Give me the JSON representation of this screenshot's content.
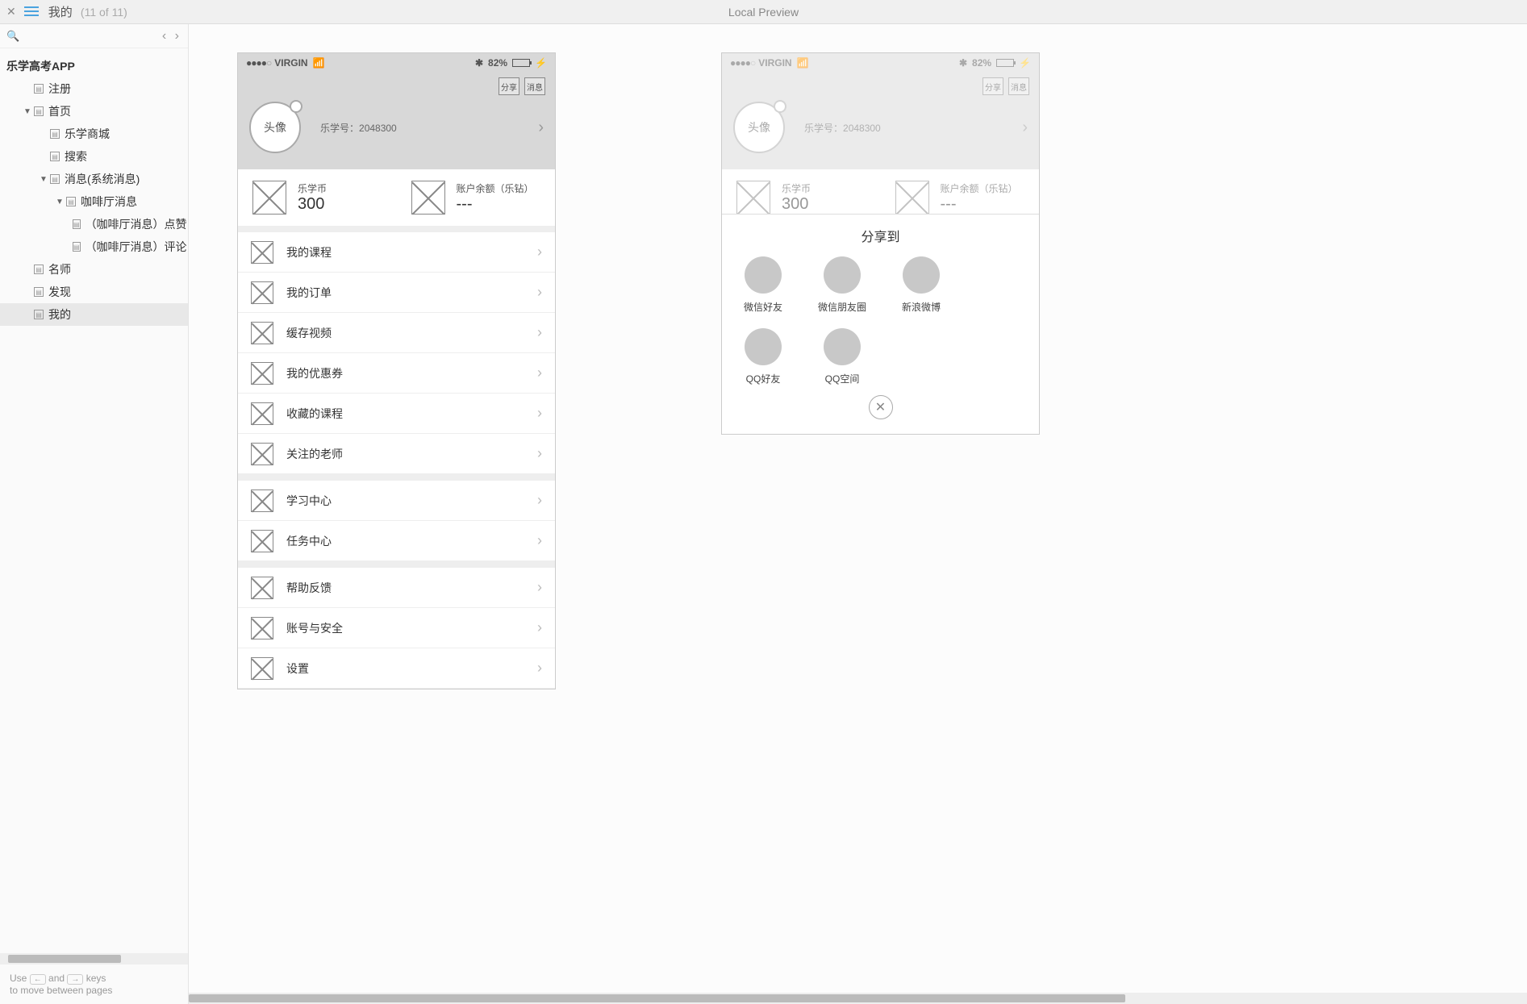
{
  "topbar": {
    "title": "我的",
    "count": "(11 of 11)",
    "preview": "Local Preview"
  },
  "tree": {
    "root": "乐学高考APP",
    "items": [
      {
        "label": "注册",
        "depth": 1
      },
      {
        "label": "首页",
        "depth": 1,
        "expandable": true
      },
      {
        "label": "乐学商城",
        "depth": 2
      },
      {
        "label": "搜索",
        "depth": 2
      },
      {
        "label": "消息(系统消息)",
        "depth": 2,
        "expandable": true
      },
      {
        "label": "咖啡厅消息",
        "depth": 3,
        "expandable": true
      },
      {
        "label": "（咖啡厅消息）点赞",
        "depth": 4
      },
      {
        "label": "（咖啡厅消息）评论",
        "depth": 4
      },
      {
        "label": "名师",
        "depth": 1
      },
      {
        "label": "发现",
        "depth": 1
      },
      {
        "label": "我的",
        "depth": 1,
        "selected": true
      }
    ]
  },
  "footer_hint1": "Use",
  "footer_hint2": "and",
  "footer_hint3": "keys",
  "footer_hint4": "to move between pages",
  "status": {
    "carrier": "VIRGIN",
    "battery": "82%"
  },
  "header": {
    "share_btn": "分享",
    "msg_btn": "消息",
    "avatar_label": "头像",
    "uid_label": "乐学号：",
    "uid": "2048300"
  },
  "balance": {
    "coin_label": "乐学币",
    "coin_value": "300",
    "balance_label": "账户余额（乐钻）",
    "balance_value": "---"
  },
  "menu_groups": [
    [
      "我的课程",
      "我的订单",
      "缓存视频",
      "我的优惠券",
      "收藏的课程",
      "关注的老师"
    ],
    [
      "学习中心",
      "任务中心"
    ],
    [
      "帮助反馈",
      "账号与安全",
      "设置"
    ]
  ],
  "share": {
    "title": "分享到",
    "options": [
      "微信好友",
      "微信朋友圈",
      "新浪微博",
      "QQ好友",
      "QQ空间"
    ]
  }
}
